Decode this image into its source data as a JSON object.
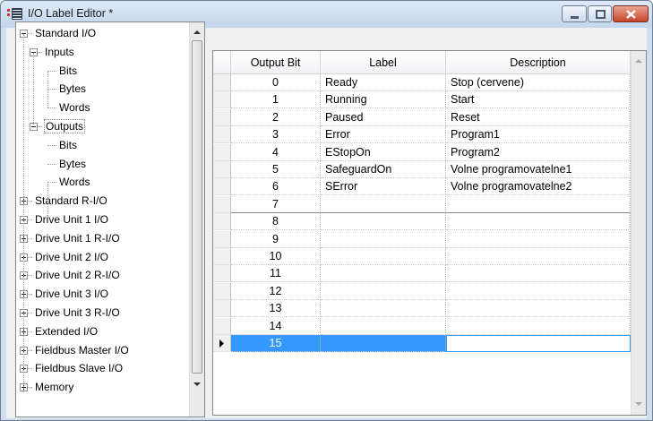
{
  "window": {
    "title": "I/O Label Editor *"
  },
  "tree": {
    "items": [
      {
        "label": "Standard I/O",
        "expanded": true
      },
      {
        "label": "Inputs",
        "expanded": true
      },
      {
        "label": "Bits"
      },
      {
        "label": "Bytes"
      },
      {
        "label": "Words"
      },
      {
        "label": "Outputs",
        "expanded": true,
        "selected": true
      },
      {
        "label": "Bits"
      },
      {
        "label": "Bytes"
      },
      {
        "label": "Words"
      },
      {
        "label": "Standard R-I/O",
        "expanded": false
      },
      {
        "label": "Drive Unit 1 I/O",
        "expanded": false
      },
      {
        "label": "Drive Unit 1 R-I/O",
        "expanded": false
      },
      {
        "label": "Drive Unit 2 I/O",
        "expanded": false
      },
      {
        "label": "Drive Unit 2 R-I/O",
        "expanded": false
      },
      {
        "label": "Drive Unit 3 I/O",
        "expanded": false
      },
      {
        "label": "Drive Unit 3 R-I/O",
        "expanded": false
      },
      {
        "label": "Extended I/O",
        "expanded": false
      },
      {
        "label": "Fieldbus Master I/O",
        "expanded": false
      },
      {
        "label": "Fieldbus Slave I/O",
        "expanded": false
      },
      {
        "label": "Memory",
        "expanded": false
      }
    ]
  },
  "grid": {
    "columns": [
      "Output Bit",
      "Label",
      "Description"
    ],
    "rows": [
      {
        "bit": "0",
        "label": "Ready",
        "description": "Stop (cervene)"
      },
      {
        "bit": "1",
        "label": "Running",
        "description": "Start"
      },
      {
        "bit": "2",
        "label": "Paused",
        "description": "Reset"
      },
      {
        "bit": "3",
        "label": "Error",
        "description": "Program1"
      },
      {
        "bit": "4",
        "label": "EStopOn",
        "description": "Program2"
      },
      {
        "bit": "5",
        "label": "SafeguardOn",
        "description": "Volne programovatelne1"
      },
      {
        "bit": "6",
        "label": "SError",
        "description": "Volne programovatelne2"
      },
      {
        "bit": "7",
        "label": "",
        "description": ""
      },
      {
        "bit": "8",
        "label": "",
        "description": ""
      },
      {
        "bit": "9",
        "label": "",
        "description": ""
      },
      {
        "bit": "10",
        "label": "",
        "description": ""
      },
      {
        "bit": "11",
        "label": "",
        "description": ""
      },
      {
        "bit": "12",
        "label": "",
        "description": ""
      },
      {
        "bit": "13",
        "label": "",
        "description": ""
      },
      {
        "bit": "14",
        "label": "",
        "description": ""
      },
      {
        "bit": "15",
        "label": "",
        "description": "",
        "selected": true
      }
    ]
  },
  "icons": {
    "app": "io-editor-icon",
    "row_pointer": "current-row-arrow-icon"
  },
  "colors": {
    "selection": "#3399ff",
    "close_button": "#c8432b"
  }
}
